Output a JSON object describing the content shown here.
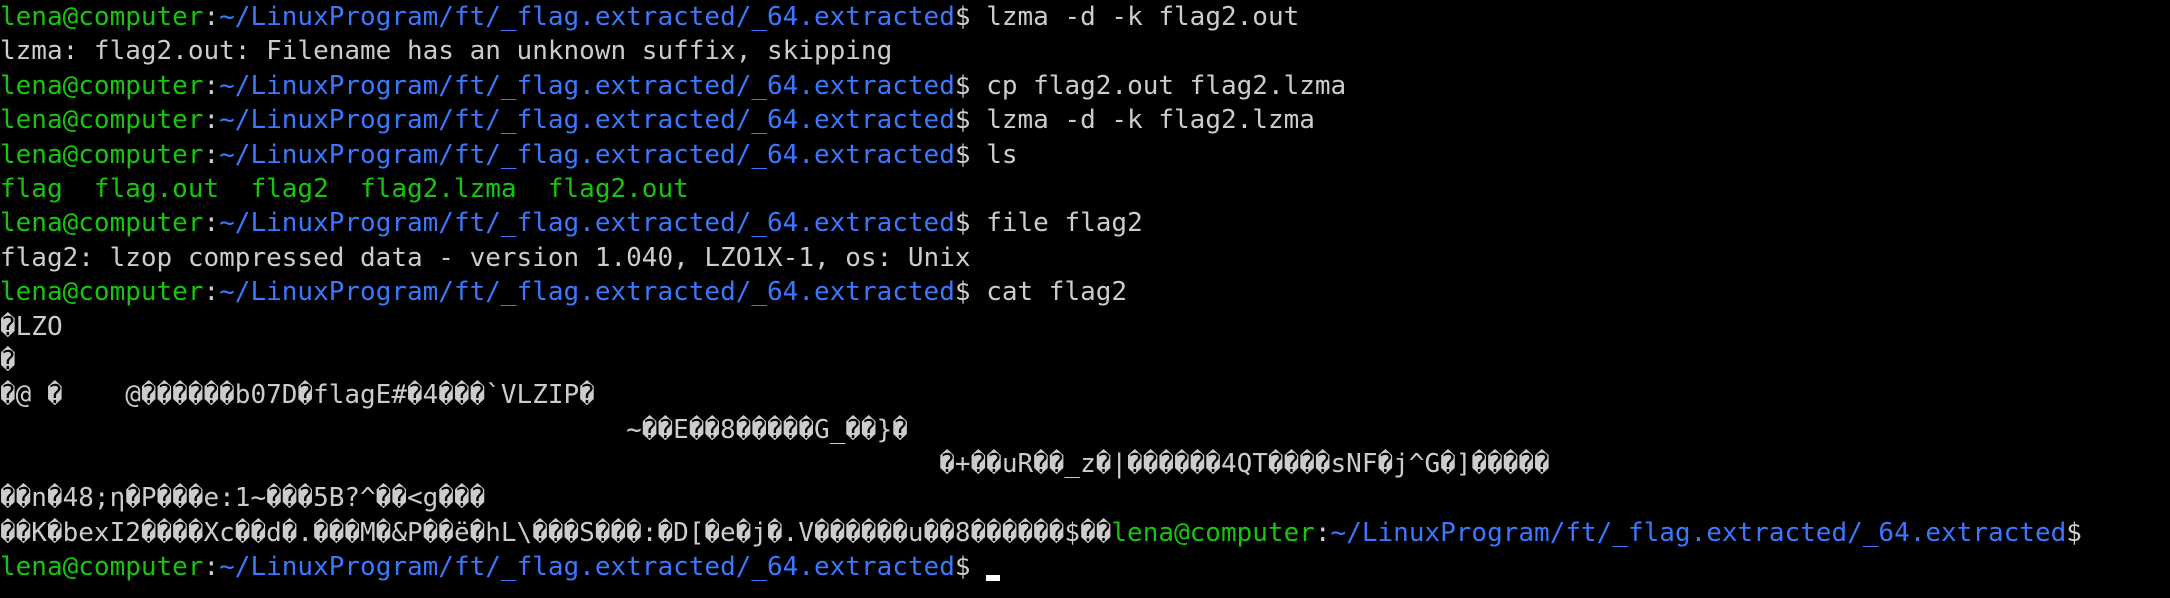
{
  "prompt": {
    "user_host": "lena@computer",
    "separator": ":",
    "path": "~/LinuxProgram/ft/_flag.extracted/_64.extracted",
    "symbol": "$ "
  },
  "lines": [
    {
      "type": "command",
      "command": "lzma -d -k flag2.out"
    },
    {
      "type": "output",
      "text": "lzma: flag2.out: Filename has an unknown suffix, skipping"
    },
    {
      "type": "command",
      "command": "cp flag2.out flag2.lzma"
    },
    {
      "type": "command",
      "command": "lzma -d -k flag2.lzma"
    },
    {
      "type": "command",
      "command": "ls"
    },
    {
      "type": "listing",
      "text": "flag  flag.out  flag2  flag2.lzma  flag2.out"
    },
    {
      "type": "command",
      "command": "file flag2"
    },
    {
      "type": "output",
      "text": "flag2: lzop compressed data - version 1.040, LZO1X-1, os: Unix"
    },
    {
      "type": "command",
      "command": "cat flag2"
    },
    {
      "type": "binary",
      "text": "�LZO"
    },
    {
      "type": "binary",
      "text": "�"
    },
    {
      "type": "binary",
      "text": "�@ �    @������b07D�flagE#�4���`VLZIP�"
    },
    {
      "type": "binary",
      "text": "                                        ~��E��8�����G_��}�"
    },
    {
      "type": "binary",
      "text": "                                                            �+��uR��_z�|������4QT����sNF�j^G�]�����"
    },
    {
      "type": "binary",
      "text": "��n�48;η�P���e:1~���5B?^��<g���"
    },
    {
      "type": "binary_prompt",
      "text": "��K�bexI2����Xc��d�.���M�&P��ë�hL\\���S���:�D[�e�j�.V������u��8������$��",
      "symbol": "$"
    },
    {
      "type": "active_prompt"
    }
  ],
  "cursor": "cursor"
}
